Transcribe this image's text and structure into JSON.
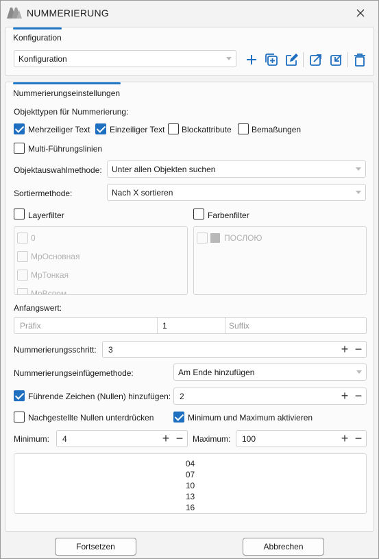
{
  "window": {
    "title": "NUMMERIERUNG",
    "icons": [
      "app-logo-icon",
      "close-icon"
    ]
  },
  "config_panel": {
    "tab_label": "Konfiguration",
    "selected": "Konfiguration",
    "toolbar_icons": [
      "plus-icon",
      "add-copy-icon",
      "edit-icon",
      "export-icon",
      "import-icon",
      "trash-icon"
    ]
  },
  "settings_panel": {
    "tab_label": "Nummerierungseinstellungen",
    "object_types_label": "Objekttypen für Nummerierung:",
    "object_types": [
      {
        "label": "Mehrzeiliger Text",
        "checked": true
      },
      {
        "label": "Einzeiliger Text",
        "checked": true
      },
      {
        "label": "Blockattribute",
        "checked": false
      },
      {
        "label": "Bemaßungen",
        "checked": false
      },
      {
        "label": "Multi-Führungslinien",
        "checked": false
      }
    ],
    "selection_method": {
      "label": "Objektauswahlmethode:",
      "value": "Unter allen Objekten suchen"
    },
    "sort_method": {
      "label": "Sortiermethode:",
      "value": "Nach X sortieren"
    },
    "layer_filter": {
      "label": "Layerfilter",
      "checked": false,
      "items": [
        "0",
        "МрОсновная",
        "МрТонкая",
        "МрВспом"
      ]
    },
    "color_filter": {
      "label": "Farbenfilter",
      "checked": false,
      "items": [
        {
          "label": "ПОСЛОЮ",
          "color": "#b8b8b8"
        }
      ]
    },
    "start_value": {
      "label": "Anfangswert:",
      "prefix_placeholder": "Präfix",
      "value": "1",
      "suffix_placeholder": "Suffix"
    },
    "step": {
      "label": "Nummerierungsschritt:",
      "value": "3"
    },
    "insert_method": {
      "label": "Nummerierungseinfügemethode:",
      "value": "Am Ende hinzufügen"
    },
    "leading_zeros": {
      "label": "Führende Zeichen (Nullen) hinzufügen:",
      "checked": true,
      "value": "2"
    },
    "trailing_zeros": {
      "label": "Nachgestellte Nullen unterdrücken",
      "checked": false
    },
    "min_max": {
      "label": "Minimum und Maximum aktivieren",
      "checked": true
    },
    "minimum": {
      "label": "Minimum:",
      "value": "4"
    },
    "maximum": {
      "label": "Maximum:",
      "value": "100"
    },
    "preview": [
      "04",
      "07",
      "10",
      "13",
      "16"
    ],
    "stepper_plus": "+",
    "stepper_minus": "−"
  },
  "footer": {
    "continue": "Fortsetzen",
    "cancel": "Abbrechen"
  },
  "colors": {
    "accent": "#1f6fc0",
    "tab_underline": "#1f78c8"
  }
}
